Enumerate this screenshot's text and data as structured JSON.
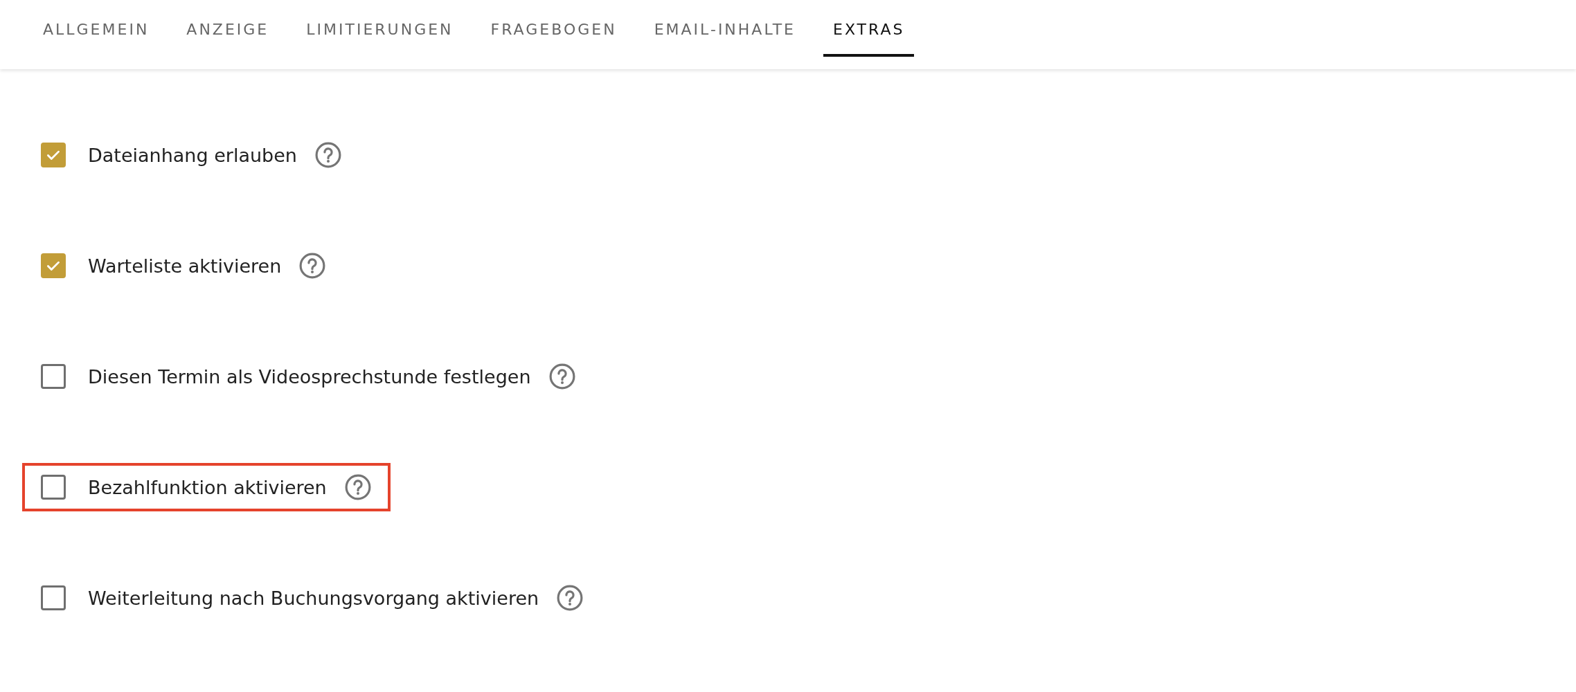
{
  "tabs": [
    {
      "label": "ALLGEMEIN",
      "selected": false
    },
    {
      "label": "ANZEIGE",
      "selected": false
    },
    {
      "label": "LIMITIERUNGEN",
      "selected": false
    },
    {
      "label": "FRAGEBOGEN",
      "selected": false
    },
    {
      "label": "EMAIL-INHALTE",
      "selected": false
    },
    {
      "label": "EXTRAS",
      "selected": true
    }
  ],
  "options": [
    {
      "label": "Dateianhang erlauben",
      "checked": true,
      "highlighted": false
    },
    {
      "label": "Warteliste aktivieren",
      "checked": true,
      "highlighted": false
    },
    {
      "label": "Diesen Termin als Videosprechstunde festlegen",
      "checked": false,
      "highlighted": false
    },
    {
      "label": "Bezahlfunktion aktivieren",
      "checked": false,
      "highlighted": true
    },
    {
      "label": "Weiterleitung nach Buchungsvorgang aktivieren",
      "checked": false,
      "highlighted": false
    }
  ]
}
